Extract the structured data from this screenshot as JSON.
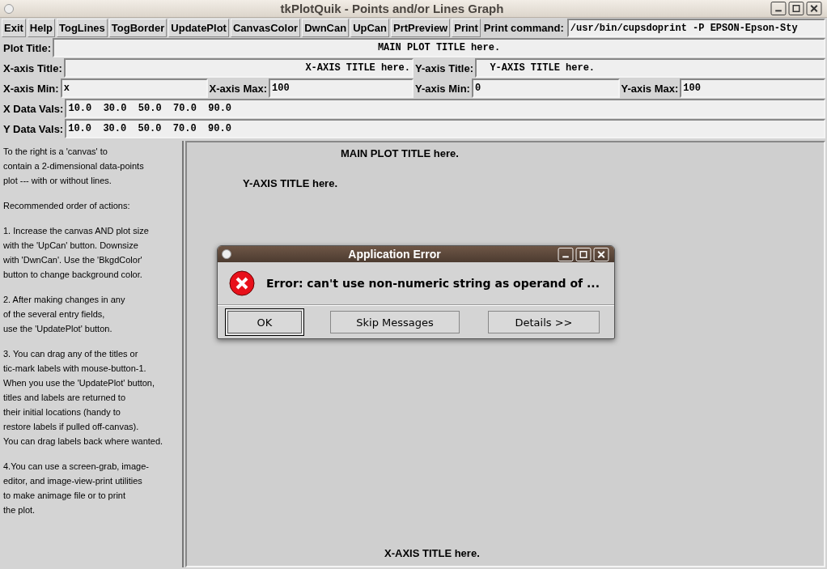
{
  "window": {
    "title": "tkPlotQuik - Points and/or Lines Graph"
  },
  "toolbar": [
    "Exit",
    "Help",
    "TogLines",
    "TogBorder",
    "UpdatePlot",
    "CanvasColor",
    "DwnCan",
    "UpCan",
    "PrtPreview",
    "Print"
  ],
  "print_command": {
    "label": "Print command:",
    "value": "/usr/bin/cupsdoprint -P EPSON-Epson-Sty"
  },
  "rows": [
    [
      {
        "label": "Plot Title:",
        "value": "MAIN PLOT TITLE here."
      }
    ],
    [
      {
        "label": "X-axis Title:",
        "value": "X-AXIS TITLE here."
      },
      {
        "label": "Y-axis Title:",
        "value": "  Y-AXIS TITLE here."
      }
    ],
    [
      {
        "label": "X-axis Min:",
        "value": "x"
      },
      {
        "label": "X-axis Max:",
        "value": "100"
      },
      {
        "label": "Y-axis Min:",
        "value": "0"
      },
      {
        "label": "Y-axis Max:",
        "value": "100"
      }
    ],
    [
      {
        "label": "X Data Vals:",
        "value": "10.0  30.0  50.0  70.0  90.0"
      }
    ],
    [
      {
        "label": "Y Data Vals:",
        "value": "10.0  30.0  50.0  70.0  90.0"
      }
    ]
  ],
  "help_text": [
    "To the right is a 'canvas' to\ncontain a 2-dimensional data-points\nplot --- with or without lines.",
    "Recommended order of actions:",
    "1. Increase the canvas AND plot size\nwith the 'UpCan' button. Downsize\nwith 'DwnCan'. Use the 'BkgdColor'\nbutton to change background color.",
    "2. After making changes in any\nof the several entry fields,\nuse the 'UpdatePlot' button.",
    "3. You can drag any of the titles or\ntic-mark labels with mouse-button-1.\nWhen you use the 'UpdatePlot' button,\ntitles and labels are returned to\ntheir initial locations (handy to\nrestore labels if pulled off-canvas).\nYou can drag labels back where wanted.",
    "4.You can use a screen-grab, image-\neditor, and image-view-print utilities\nto make animage file or to print\nthe plot."
  ],
  "canvas": {
    "plot_title": "MAIN PLOT TITLE here.",
    "y_axis_title": "Y-AXIS TITLE here.",
    "x_axis_title": "X-AXIS TITLE here."
  },
  "dialog": {
    "title": "Application Error",
    "message": "Error: can't use non-numeric string as operand of ...",
    "buttons": [
      {
        "label": "OK",
        "focused": true
      },
      {
        "label": "Skip Messages",
        "focused": false
      },
      {
        "label": "Details >>",
        "focused": false
      }
    ]
  }
}
